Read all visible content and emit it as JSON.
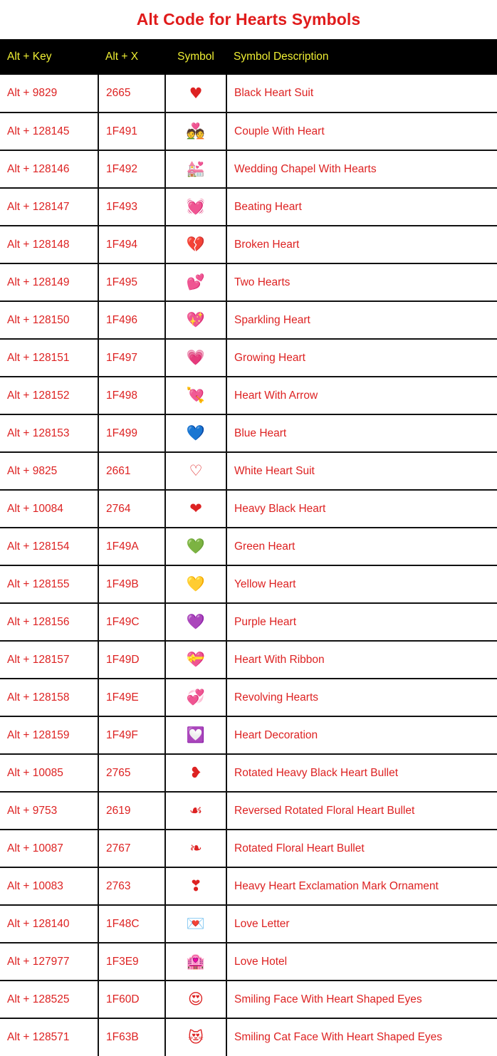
{
  "page": {
    "title": "Alt Code for Hearts Symbols"
  },
  "colors": {
    "title_red": "#e01b1b",
    "text_red": "#dd2222",
    "header_bg": "#000000",
    "header_text_yellow": "#eeee33",
    "border": "#111111",
    "page_bg": "#ffffff"
  },
  "table": {
    "columns": [
      {
        "key": "alt_key",
        "label": "Alt + Key",
        "align": "left"
      },
      {
        "key": "alt_x",
        "label": "Alt + X",
        "align": "left"
      },
      {
        "key": "symbol",
        "label": "Symbol",
        "align": "center"
      },
      {
        "key": "description",
        "label": "Symbol Description",
        "align": "left"
      }
    ],
    "rows": [
      {
        "alt_key": "Alt + 9829",
        "alt_x": "2665",
        "symbol": "♥",
        "icon_name": "black-heart-suit-symbol",
        "description": "Black Heart Suit"
      },
      {
        "alt_key": "Alt + 128145",
        "alt_x": "1F491",
        "symbol": "💑",
        "icon_name": "couple-with-heart-symbol",
        "description": "Couple With Heart"
      },
      {
        "alt_key": "Alt + 128146",
        "alt_x": "1F492",
        "symbol": "💒",
        "icon_name": "wedding-chapel-with-hearts-symbol",
        "description": "Wedding Chapel With Hearts"
      },
      {
        "alt_key": "Alt + 128147",
        "alt_x": "1F493",
        "symbol": "💓",
        "icon_name": "beating-heart-symbol",
        "description": "Beating Heart"
      },
      {
        "alt_key": "Alt + 128148",
        "alt_x": "1F494",
        "symbol": "💔",
        "icon_name": "broken-heart-symbol",
        "description": "Broken Heart"
      },
      {
        "alt_key": "Alt + 128149",
        "alt_x": "1F495",
        "symbol": "💕",
        "icon_name": "two-hearts-symbol",
        "description": "Two Hearts"
      },
      {
        "alt_key": "Alt + 128150",
        "alt_x": "1F496",
        "symbol": "💖",
        "icon_name": "sparkling-heart-symbol",
        "description": "Sparkling Heart"
      },
      {
        "alt_key": "Alt + 128151",
        "alt_x": "1F497",
        "symbol": "💗",
        "icon_name": "growing-heart-symbol",
        "description": "Growing Heart"
      },
      {
        "alt_key": "Alt + 128152",
        "alt_x": "1F498",
        "symbol": "💘",
        "icon_name": "heart-with-arrow-symbol",
        "description": "Heart With Arrow"
      },
      {
        "alt_key": "Alt + 128153",
        "alt_x": "1F499",
        "symbol": "💙",
        "icon_name": "blue-heart-symbol",
        "description": "Blue Heart"
      },
      {
        "alt_key": "Alt + 9825",
        "alt_x": "2661",
        "symbol": "♡",
        "icon_name": "white-heart-suit-symbol",
        "description": "White Heart Suit"
      },
      {
        "alt_key": "Alt + 10084",
        "alt_x": "2764",
        "symbol": "❤",
        "icon_name": "heavy-black-heart-symbol",
        "description": "Heavy Black Heart"
      },
      {
        "alt_key": "Alt + 128154",
        "alt_x": "1F49A",
        "symbol": "💚",
        "icon_name": "green-heart-symbol",
        "description": "Green Heart"
      },
      {
        "alt_key": "Alt + 128155",
        "alt_x": "1F49B",
        "symbol": "💛",
        "icon_name": "yellow-heart-symbol",
        "description": "Yellow Heart"
      },
      {
        "alt_key": "Alt + 128156",
        "alt_x": "1F49C",
        "symbol": "💜",
        "icon_name": "purple-heart-symbol",
        "description": "Purple Heart"
      },
      {
        "alt_key": "Alt + 128157",
        "alt_x": "1F49D",
        "symbol": "💝",
        "icon_name": "heart-with-ribbon-symbol",
        "description": "Heart With Ribbon"
      },
      {
        "alt_key": "Alt + 128158",
        "alt_x": "1F49E",
        "symbol": "💞",
        "icon_name": "revolving-hearts-symbol",
        "description": "Revolving Hearts"
      },
      {
        "alt_key": "Alt + 128159",
        "alt_x": "1F49F",
        "symbol": "💟",
        "icon_name": "heart-decoration-symbol",
        "description": "Heart Decoration"
      },
      {
        "alt_key": "Alt + 10085",
        "alt_x": "2765",
        "symbol": "❥",
        "icon_name": "rotated-heavy-black-heart-bullet-symbol",
        "description": "Rotated Heavy Black Heart Bullet"
      },
      {
        "alt_key": "Alt + 9753",
        "alt_x": "2619",
        "symbol": "☙",
        "icon_name": "reversed-rotated-floral-heart-bullet-symbol",
        "description": "Reversed Rotated Floral Heart Bullet"
      },
      {
        "alt_key": "Alt + 10087",
        "alt_x": "2767",
        "symbol": "❧",
        "icon_name": "rotated-floral-heart-bullet-symbol",
        "description": "Rotated Floral Heart Bullet"
      },
      {
        "alt_key": "Alt + 10083",
        "alt_x": "2763",
        "symbol": "❣",
        "icon_name": "heavy-heart-exclamation-mark-ornament-symbol",
        "description": "Heavy Heart Exclamation Mark Ornament"
      },
      {
        "alt_key": "Alt + 128140",
        "alt_x": "1F48C",
        "symbol": "💌",
        "icon_name": "love-letter-symbol",
        "description": "Love Letter"
      },
      {
        "alt_key": "Alt + 127977",
        "alt_x": "1F3E9",
        "symbol": "🏩",
        "icon_name": "love-hotel-symbol",
        "description": "Love Hotel"
      },
      {
        "alt_key": "Alt + 128525",
        "alt_x": "1F60D",
        "symbol": "😍",
        "icon_name": "smiling-face-with-heart-shaped-eyes-symbol",
        "description": "Smiling Face With Heart Shaped Eyes"
      },
      {
        "alt_key": "Alt + 128571",
        "alt_x": "1F63B",
        "symbol": "😻",
        "icon_name": "smiling-cat-face-with-heart-shaped-eyes-symbol",
        "description": "Smiling Cat Face With Heart Shaped Eyes"
      }
    ]
  }
}
